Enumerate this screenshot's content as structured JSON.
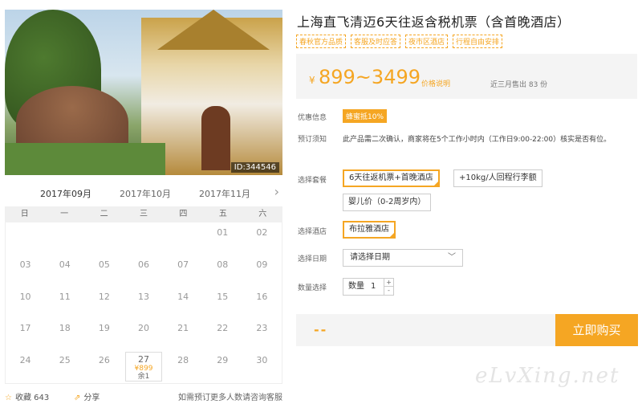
{
  "photo": {
    "id_tag": "ID:344546"
  },
  "calendar": {
    "months": [
      "2017年09月",
      "2017年10月",
      "2017年11月"
    ],
    "next_label": "›",
    "weekdays": [
      "日",
      "一",
      "二",
      "三",
      "四",
      "五",
      "六"
    ],
    "rows": [
      [
        "",
        "",
        "",
        "",
        "",
        "01",
        "02"
      ],
      [
        "03",
        "04",
        "05",
        "06",
        "07",
        "08",
        "09"
      ],
      [
        "10",
        "11",
        "12",
        "13",
        "14",
        "15",
        "16"
      ],
      [
        "17",
        "18",
        "19",
        "20",
        "21",
        "22",
        "23"
      ],
      [
        "24",
        "25",
        "26",
        "27",
        "28",
        "29",
        "30"
      ]
    ],
    "selected_day": {
      "day": "27",
      "price": "¥899",
      "remaining": "余1"
    }
  },
  "bottom": {
    "fav_icon": "star-icon",
    "fav_label": "收藏 643",
    "share_icon": "share-icon",
    "share_label": "分享",
    "note": "如需预订更多人数请咨询客服"
  },
  "product": {
    "title": "上海直飞清迈6天往返含税机票（含首晚酒店）",
    "tags": [
      "春秋官方品质",
      "客服及时应答",
      "夜市区酒店",
      "行程自由安排"
    ],
    "currency": "¥",
    "price_range": "899~3499",
    "price_note": "价格说明",
    "sold": "近三月售出 83 份"
  },
  "rows": {
    "promo_label": "优惠信息",
    "promo_badge": "蜂蜜抵10%",
    "notice_label": "预订须知",
    "notice_text": "此产品需二次确认，商家将在5个工作小时内（工作日9:00-22:00）核实是否有位。",
    "package_label": "选择套餐",
    "packages": [
      "6天往返机票+首晚酒店",
      "+10kg/人回程行李额",
      "婴儿价（0-2周岁内）"
    ],
    "hotel_label": "选择酒店",
    "hotel": "布拉雅酒店",
    "date_label": "选择日期",
    "date_placeholder": "请选择日期",
    "qty_label": "数量选择",
    "qty_text": "数量",
    "qty_value": "1"
  },
  "buy": {
    "dash": "--",
    "button": "立即购买"
  },
  "watermark": "eLvXing.net",
  "colors": {
    "accent": "#f5a623"
  }
}
